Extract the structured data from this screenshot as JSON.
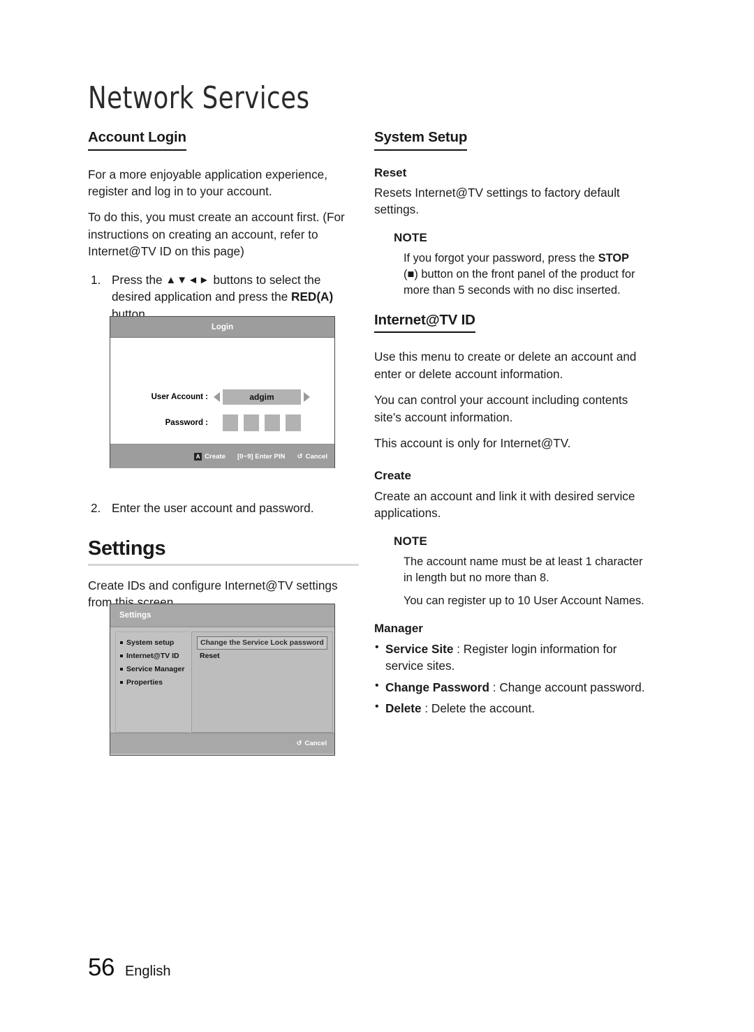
{
  "chapter": {
    "title": "Network Services"
  },
  "footer": {
    "page_number": "56",
    "language": "English"
  },
  "left": {
    "account_login": {
      "heading": "Account Login",
      "paragraphs": [
        "For a more enjoyable application experience, register and log in to your account.",
        "To do this, you must create an account first. (For instructions on creating an account, refer to Internet@TV ID on this page)"
      ],
      "step1": {
        "number": "1.",
        "text_a": "Press the ",
        "arrows": "▲▼◄►",
        "text_b": " buttons to select the desired application and press the ",
        "bold": "RED(A)",
        "text_c": " button."
      },
      "step2": {
        "number": "2.",
        "text": "Enter the user account and password."
      }
    },
    "login_ui": {
      "title": "Login",
      "user_account_label": "User Account :",
      "user_account_value": "adgim",
      "password_label": "Password :",
      "footer": {
        "create_key": "A",
        "create_label": "Create",
        "pin_label": "[0~9] Enter PIN",
        "cancel_icon": "↺",
        "cancel_label": "Cancel"
      }
    },
    "settings": {
      "heading": "Settings",
      "paragraph": "Create IDs and configure Internet@TV settings from this screen."
    },
    "settings_ui": {
      "title": "Settings",
      "menu": [
        "System setup",
        "Internet@TV ID",
        "Service Manager",
        "Properties"
      ],
      "options_highlighted": "Change the Service Lock password",
      "options": [
        "Reset"
      ],
      "footer": {
        "cancel_icon": "↺",
        "cancel_label": "Cancel"
      }
    }
  },
  "right": {
    "system_setup": {
      "heading": "System Setup",
      "reset_title": "Reset",
      "reset_text": "Resets Internet@TV settings to factory default settings.",
      "note": {
        "title": "NOTE",
        "text_a": "If you forgot your password, press the ",
        "bold": "STOP",
        "text_b": " (■) button on the front panel of the product for more than 5 seconds with no disc inserted."
      }
    },
    "internet_tv_id": {
      "heading": "Internet@TV ID",
      "paragraphs": [
        "Use this menu to create or delete an account and enter or delete account information.",
        "You can control your account including contents site’s account information.",
        "This account is only for Internet@TV."
      ],
      "create_title": "Create",
      "create_text": "Create an account and link it with desired service applications.",
      "note": {
        "title": "NOTE",
        "line1": "The account name must be at least 1 character in length but no more than 8.",
        "line2": "You can register up to 10 User Account Names."
      },
      "manager_title": "Manager",
      "manager_items": [
        {
          "bold": "Service Site",
          "rest": " : Register login information for service sites."
        },
        {
          "bold": "Change Password",
          "rest": " : Change account password."
        },
        {
          "bold": "Delete",
          "rest": " : Delete the account."
        }
      ]
    }
  }
}
